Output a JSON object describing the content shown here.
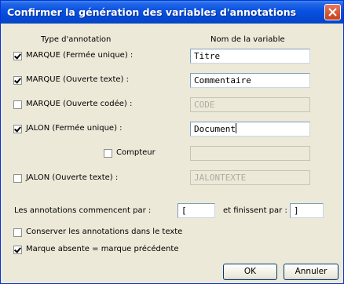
{
  "window": {
    "title": "Confirmer la génération des variables d'annotations"
  },
  "headers": {
    "type": "Type d'annotation",
    "name": "Nom de la variable"
  },
  "rows": [
    {
      "label": "MARQUE (Fermée unique) :",
      "checked": true,
      "value": "Titre",
      "enabled": true
    },
    {
      "label": "MARQUE (Ouverte texte) :",
      "checked": true,
      "value": "Commentaire",
      "enabled": true
    },
    {
      "label": "MARQUE (Ouverte codée) :",
      "checked": false,
      "value": "CODE",
      "enabled": false
    },
    {
      "label": "JALON (Fermée unique) :",
      "checked": true,
      "value": "Document",
      "enabled": true
    },
    {
      "label": "Compteur",
      "checked": false,
      "value": "",
      "enabled": false
    },
    {
      "label": "JALON (Ouverte texte) :",
      "checked": false,
      "value": "JALONTEXTE",
      "enabled": false
    }
  ],
  "delimiters": {
    "start_label": "Les annotations commencent par :",
    "start_value": "[",
    "end_label": "et finissent par :",
    "end_value": "]"
  },
  "options": [
    {
      "label": "Conserver les annotations dans le texte",
      "checked": false
    },
    {
      "label": "Marque absente = marque précédente",
      "checked": true
    }
  ],
  "buttons": {
    "ok": "OK",
    "cancel": "Annuler"
  }
}
